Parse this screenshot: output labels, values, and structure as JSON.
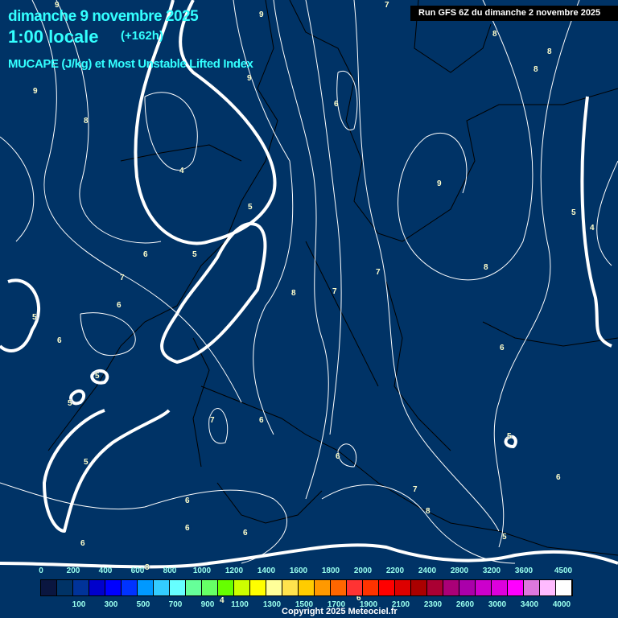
{
  "header": {
    "date": "dimanche 9 novembre 2025",
    "time": "1:00 locale",
    "offset": "(+162h)",
    "parameter": "MUCAPE (J/kg) et Most Unstable Lifted Index",
    "run": "Run GFS 6Z du dimanche 2 novembre 2025"
  },
  "contour_labels": [
    "9",
    "9",
    "7",
    "8",
    "8",
    "8",
    "9",
    "9",
    "6",
    "8",
    "4",
    "5",
    "9",
    "5",
    "4",
    "6",
    "5",
    "7",
    "6",
    "8",
    "7",
    "7",
    "8",
    "5",
    "6",
    "6",
    "5",
    "5",
    "7",
    "6",
    "6",
    "5",
    "5",
    "7",
    "8",
    "6",
    "6",
    "6",
    "6",
    "6",
    "5",
    "8",
    "4",
    "6"
  ],
  "legend": {
    "colors": [
      "#0a1640",
      "#003366",
      "#003399",
      "#0000cc",
      "#0000ff",
      "#0033ff",
      "#0099ff",
      "#33ccff",
      "#66ffff",
      "#66ff99",
      "#66ff66",
      "#66ff00",
      "#ccff00",
      "#ffff00",
      "#ffff99",
      "#ffe34d",
      "#ffcc00",
      "#ff9900",
      "#ff6600",
      "#ff3333",
      "#ff3300",
      "#ff0000",
      "#dd0000",
      "#aa0000",
      "#aa0033",
      "#aa0077",
      "#aa00aa",
      "#cc00cc",
      "#dd00dd",
      "#ff00ff",
      "#dd77dd",
      "#ffbbff",
      "#ffffff"
    ],
    "top_labels": [
      "0",
      "200",
      "400",
      "600",
      "800",
      "1000",
      "1200",
      "1400",
      "1600",
      "1800",
      "2000",
      "2200",
      "2400",
      "2800",
      "3200",
      "3600",
      "4500"
    ],
    "bottom_labels": [
      "100",
      "300",
      "500",
      "700",
      "900",
      "1100",
      "1300",
      "1500",
      "1700",
      "1900",
      "2100",
      "2300",
      "2600",
      "3000",
      "3400",
      "4000"
    ]
  },
  "copyright": "Copyright 2025 Meteociel.fr"
}
